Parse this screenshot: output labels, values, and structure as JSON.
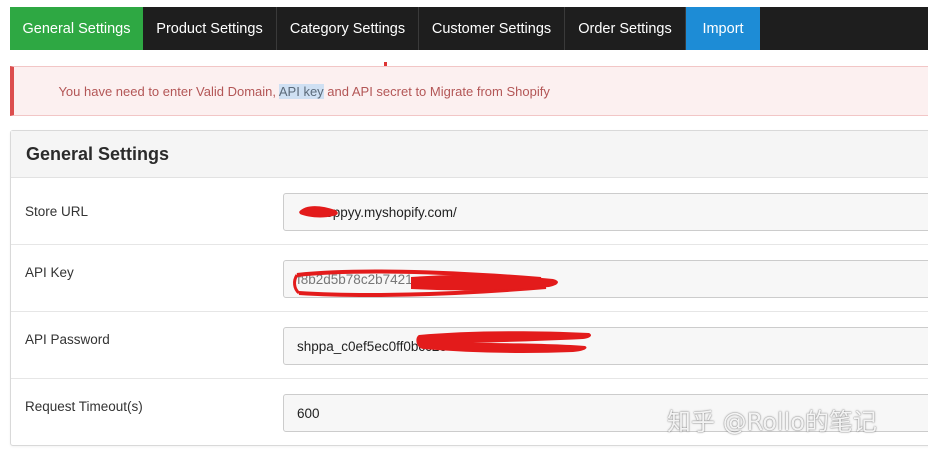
{
  "tabs": [
    {
      "label": "General Settings",
      "state": "active"
    },
    {
      "label": "Product Settings",
      "state": "normal"
    },
    {
      "label": "Category Settings",
      "state": "normal"
    },
    {
      "label": "Customer Settings",
      "state": "normal"
    },
    {
      "label": "Order Settings",
      "state": "normal"
    },
    {
      "label": "Import",
      "state": "import"
    }
  ],
  "alert": {
    "before": "You have need to enter Valid Domain, ",
    "highlight": "API key",
    "after": " and API secret to Migrate from Shopify"
  },
  "panel": {
    "title": "General Settings",
    "fields": [
      {
        "label": "Store URL",
        "value": "shoppyy.myshopify.com/"
      },
      {
        "label": "API Key",
        "value": "f8b2d5b78c2b7421"
      },
      {
        "label": "API Password",
        "value": "shppa_c0ef5ec0ff0bcc2e"
      },
      {
        "label": "Request Timeout(s)",
        "value": "600"
      }
    ]
  },
  "watermark": "知乎 @Rollo的笔记",
  "colors": {
    "tab_bar": "#1e1e1e",
    "tab_active": "#2ea843",
    "tab_import": "#1d8cd6",
    "alert_border": "#dc4e4e",
    "alert_text": "#b35656",
    "redaction": "#e31b1b"
  }
}
